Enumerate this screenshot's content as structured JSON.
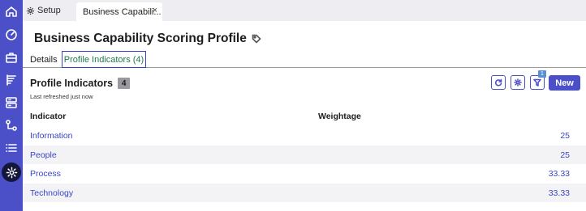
{
  "sidebar": {
    "items": [
      {
        "icon": "home-icon"
      },
      {
        "icon": "dashboard-gauge-icon"
      },
      {
        "icon": "briefcase-icon"
      },
      {
        "icon": "report-icon"
      },
      {
        "icon": "storage-icon"
      },
      {
        "icon": "workflow-icon"
      },
      {
        "icon": "list-icon"
      },
      {
        "icon": "settings-gear-icon",
        "active": true
      }
    ]
  },
  "tabs": {
    "setup_label": "Setup",
    "doc_label": "Business Capabili...",
    "close_glyph": "×"
  },
  "page": {
    "title": "Business Capability Scoring Profile"
  },
  "subtabs": {
    "details": "Details",
    "profile_indicators": "Profile Indicators (4)"
  },
  "section": {
    "title": "Profile Indicators",
    "count": "4",
    "refresh_note": "Last refreshed just now",
    "filter_count": "1",
    "new_label": "New"
  },
  "table": {
    "headers": {
      "indicator": "Indicator",
      "weightage": "Weightage"
    },
    "rows": [
      {
        "indicator": "Information",
        "weightage": "25"
      },
      {
        "indicator": "People",
        "weightage": "25"
      },
      {
        "indicator": "Process",
        "weightage": "33.33"
      },
      {
        "indicator": "Technology",
        "weightage": "33.33"
      }
    ]
  },
  "colors": {
    "rail": "#4b50c8",
    "accent": "#3a44c8",
    "active_tab_text": "#1f7a4a"
  }
}
